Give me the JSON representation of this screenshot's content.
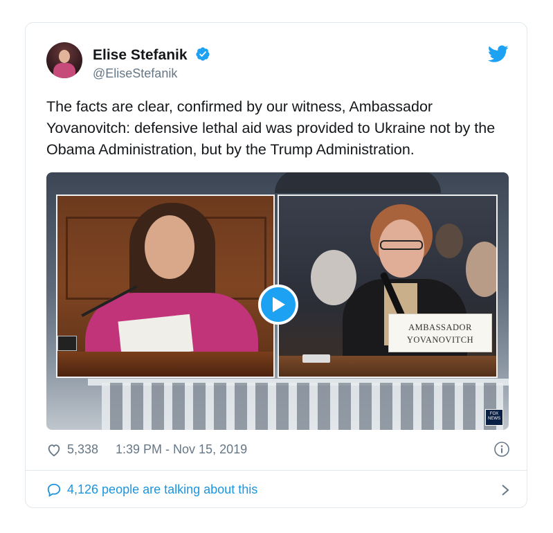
{
  "author": {
    "display_name": "Elise Stefanik",
    "handle": "@EliseStefanik"
  },
  "tweet": {
    "text": "The facts are clear, confirmed by our witness, Ambassador Yovanovitch: defensive lethal aid was provided to Ukraine not by the Obama Administration, but by the Trump Administration."
  },
  "media": {
    "nameplate_line1": "AMBASSADOR",
    "nameplate_line2": "YOVANOVITCH",
    "network_logo": "FOX NEWS"
  },
  "meta": {
    "likes": "5,338",
    "timestamp": "1:39 PM - Nov 15, 2019"
  },
  "footer": {
    "talking": "4,126 people are talking about this"
  },
  "icons": {
    "verified": "verified-badge-icon",
    "brand": "twitter-bird-icon",
    "like": "heart-icon",
    "info": "info-icon",
    "reply": "speech-bubble-icon",
    "more": "chevron-right-icon",
    "play": "play-icon"
  },
  "colors": {
    "accent": "#1da1f2",
    "link": "#1b95e0",
    "secondary_text": "#657786",
    "border": "#e1e8ed"
  }
}
